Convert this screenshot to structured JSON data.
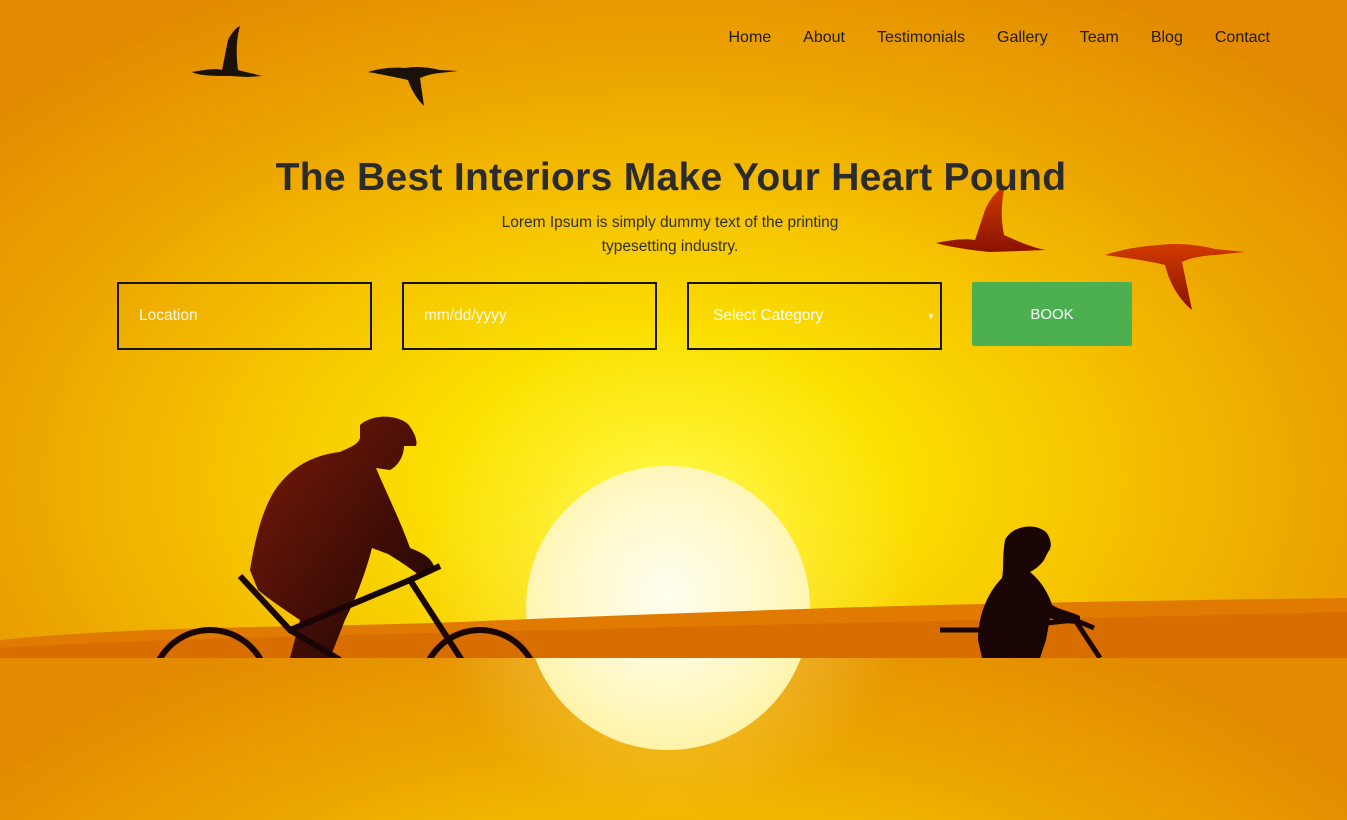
{
  "nav": {
    "items": [
      {
        "label": "Home"
      },
      {
        "label": "About"
      },
      {
        "label": "Testimonials"
      },
      {
        "label": "Gallery"
      },
      {
        "label": "Team"
      },
      {
        "label": "Blog"
      },
      {
        "label": "Contact"
      }
    ]
  },
  "hero": {
    "title": "The Best Interiors Make Your Heart Pound",
    "subtitle": "Lorem Ipsum is simply dummy text of the printing typesetting industry."
  },
  "form": {
    "location_placeholder": "Location",
    "date_placeholder": "mm/dd/yyyy",
    "category_value": "Select Category",
    "book_label": "BOOK"
  },
  "colors": {
    "book_button": "#4caf50",
    "sky_center": "#fff200",
    "sky_edge": "#e38a00",
    "ground": "#e07a00"
  },
  "icons": {
    "select_arrow": "caret-down-icon"
  }
}
